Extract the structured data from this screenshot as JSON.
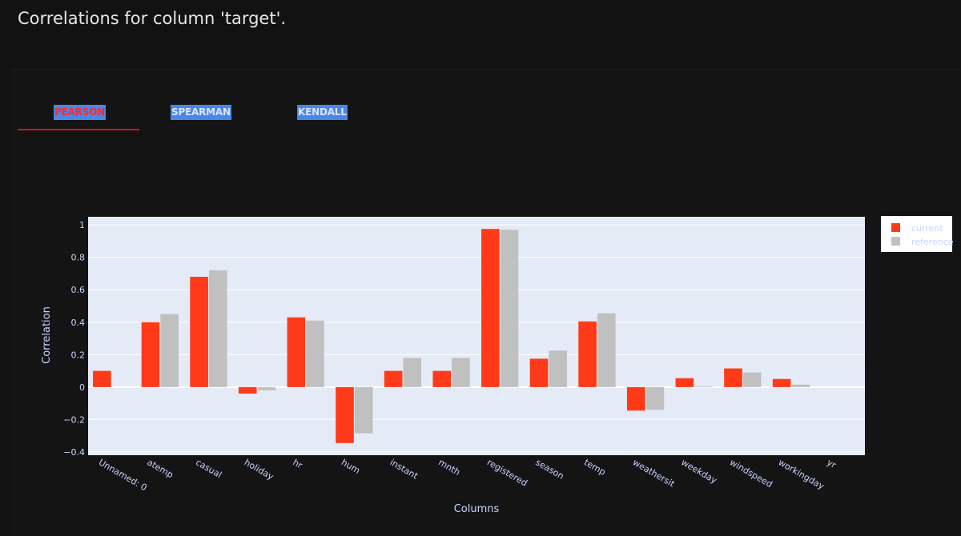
{
  "page": {
    "title": "Correlations for column 'target'."
  },
  "tabs": [
    {
      "label": "PEARSON",
      "active": true
    },
    {
      "label": "SPEARMAN",
      "active": false
    },
    {
      "label": "KENDALL",
      "active": false
    }
  ],
  "colors": {
    "current": "#ff3a18",
    "reference": "#c0c0c0",
    "plot_bg": "#e5ebf6",
    "axis_text": "#c8d6ff"
  },
  "chart_data": {
    "type": "bar",
    "xlabel": "Columns",
    "ylabel": "Correlation",
    "ylim": [
      -0.42,
      1.05
    ],
    "yticks": [
      {
        "value": 1,
        "label": "1"
      },
      {
        "value": 0.8,
        "label": "0.8"
      },
      {
        "value": 0.6,
        "label": "0.6"
      },
      {
        "value": 0.4,
        "label": "0.4"
      },
      {
        "value": 0.2,
        "label": "0.2"
      },
      {
        "value": 0,
        "label": "0"
      },
      {
        "value": -0.2,
        "label": "−0.2"
      },
      {
        "value": -0.4,
        "label": "−0.4"
      }
    ],
    "categories": [
      "Unnamed: 0",
      "atemp",
      "casual",
      "holiday",
      "hr",
      "hum",
      "instant",
      "mnth",
      "registered",
      "season",
      "temp",
      "weathersit",
      "weekday",
      "windspeed",
      "workingday",
      "yr"
    ],
    "series": [
      {
        "name": "current",
        "values": [
          0.1,
          0.4,
          0.68,
          -0.04,
          0.43,
          -0.345,
          0.1,
          0.1,
          0.975,
          0.175,
          0.405,
          -0.145,
          0.055,
          0.115,
          0.05,
          0
        ]
      },
      {
        "name": "reference",
        "values": [
          0,
          0.45,
          0.72,
          -0.02,
          0.41,
          -0.285,
          0.18,
          0.18,
          0.97,
          0.225,
          0.455,
          -0.14,
          0.005,
          0.09,
          0.015,
          0
        ]
      }
    ],
    "grid": true,
    "legend_position": "right"
  }
}
